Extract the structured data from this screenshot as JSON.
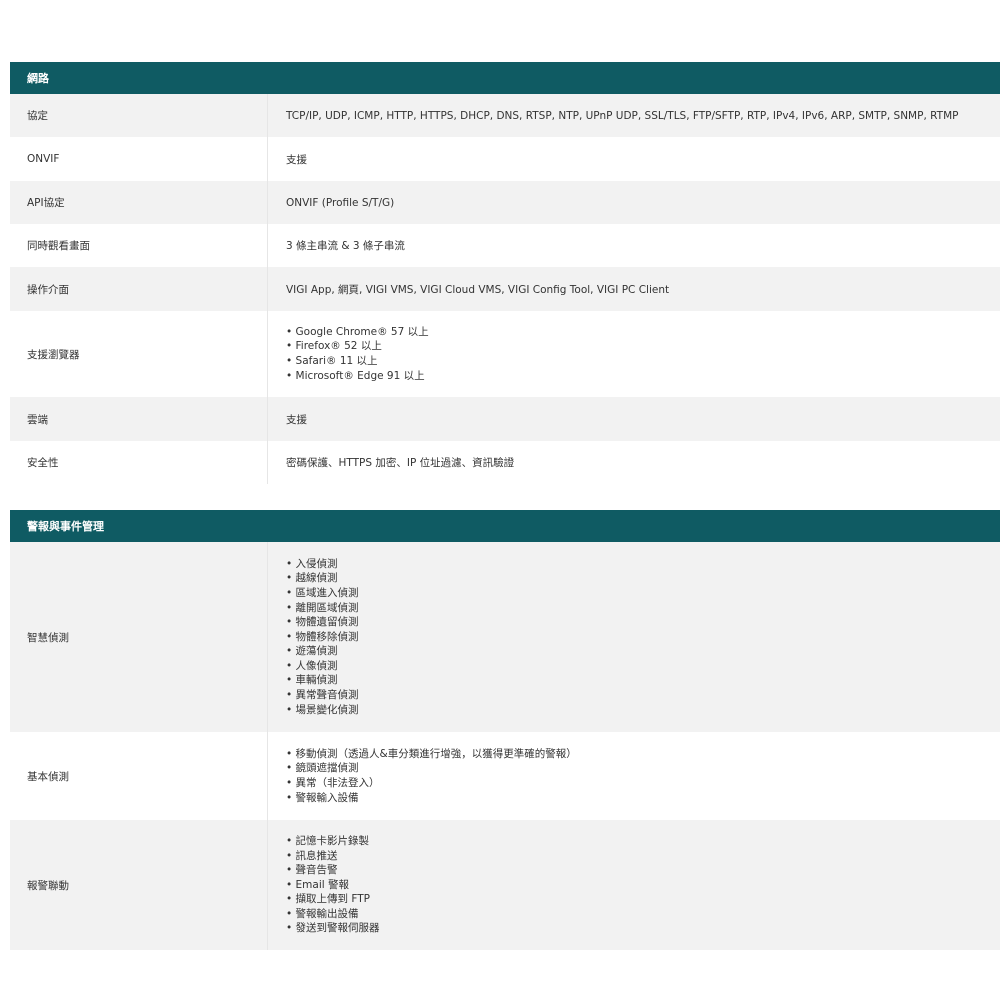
{
  "network": {
    "title": "網路",
    "rows": [
      {
        "label": "協定",
        "value": "TCP/IP, UDP, ICMP, HTTP, HTTPS, DHCP, DNS, RTSP, NTP, UPnP UDP, SSL/TLS, FTP/SFTP, RTP, IPv4, IPv6, ARP, SMTP, SNMP, RTMP"
      },
      {
        "label": "ONVIF",
        "value": "支援"
      },
      {
        "label": "API協定",
        "value": "ONVIF (Profile S/T/G)"
      },
      {
        "label": "同時觀看畫面",
        "value": "3 條主串流 & 3 條子串流"
      },
      {
        "label": "操作介面",
        "value": "VIGI App, 網頁, VIGI VMS, VIGI Cloud VMS, VIGI Config Tool, VIGI PC Client"
      },
      {
        "label": "支援瀏覽器",
        "items": [
          "Google Chrome® 57 以上",
          "Firefox® 52 以上",
          "Safari® 11 以上",
          "Microsoft® Edge 91 以上"
        ]
      },
      {
        "label": "雲端",
        "value": "支援"
      },
      {
        "label": "安全性",
        "value": "密碼保護、HTTPS 加密、IP 位址過濾、資訊驗證"
      }
    ]
  },
  "alarm": {
    "title": "警報與事件管理",
    "rows": [
      {
        "label": "智慧偵測",
        "items": [
          "入侵偵測",
          "越線偵測",
          "區域進入偵測",
          "離開區域偵測",
          "物體遺留偵測",
          "物體移除偵測",
          "遊蕩偵測",
          "人像偵測",
          "車輛偵測",
          "異常聲音偵測",
          "場景變化偵測"
        ]
      },
      {
        "label": "基本偵測",
        "items": [
          "移動偵測（透過人&車分類進行增強，以獲得更準確的警報）",
          "鏡頭遮擋偵測",
          "異常（非法登入）",
          "警報輸入設備"
        ]
      },
      {
        "label": "報警聯動",
        "items": [
          "記憶卡影片錄製",
          "訊息推送",
          "聲音告警",
          "Email 警報",
          "擷取上傳到 FTP",
          "警報輸出設備",
          "發送到警報伺服器"
        ]
      }
    ]
  }
}
